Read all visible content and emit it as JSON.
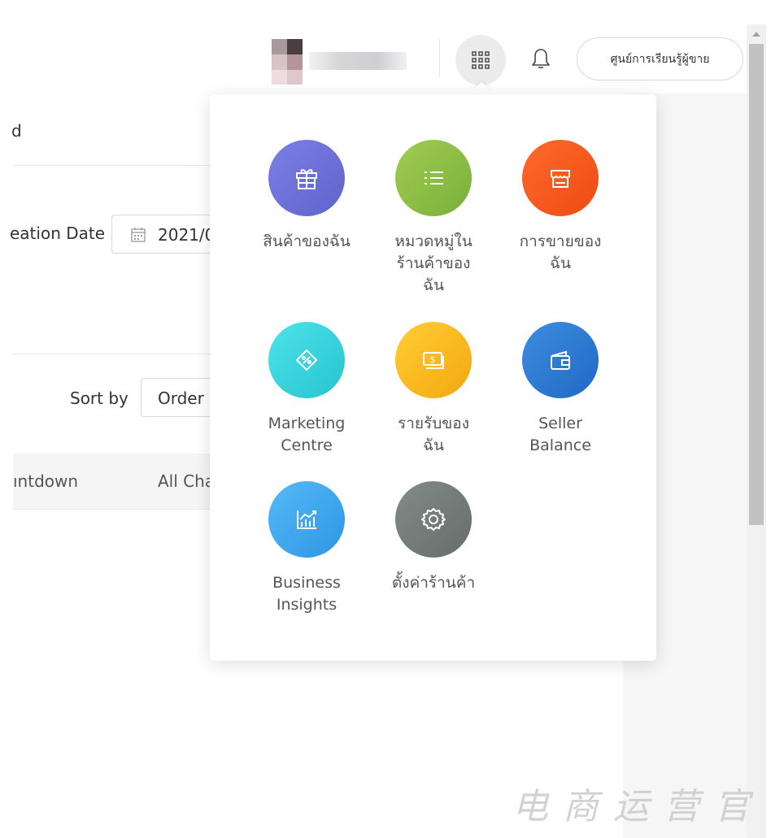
{
  "header": {
    "learning_center_label": "ศูนย์การเรียนรู้ผู้ขาย",
    "apps_icon": "grid-icon",
    "bell_icon": "bell-icon"
  },
  "page": {
    "crumb_text": "d",
    "creation_date_label": "eation Date",
    "date_value": "2021/0",
    "sort_by_label": "Sort by",
    "sort_value": "Order (",
    "table_columns": [
      "ıntdown",
      "All Cha"
    ]
  },
  "apps_menu": {
    "items": [
      {
        "label": "สินค้าของฉัน",
        "icon": "gift-icon",
        "color": "#6f74d6"
      },
      {
        "label": "หมวดหมู่ใน\nร้านค้าของ\nฉัน",
        "icon": "list-icon",
        "color": "#8bbf44"
      },
      {
        "label": "การขายของ\nฉัน",
        "icon": "store-icon",
        "color": "#f5561d"
      },
      {
        "label": "Marketing\nCentre",
        "icon": "discount-tag-icon",
        "color": "#37d2dc"
      },
      {
        "label": "รายรับของ\nฉัน",
        "icon": "money-icon",
        "color": "#fbb41c"
      },
      {
        "label": "Seller\nBalance",
        "icon": "wallet-icon",
        "color": "#2f7fd6"
      },
      {
        "label": "Business\nInsights",
        "icon": "chart-icon",
        "color": "#3fa9ef"
      },
      {
        "label": "ตั้งค่าร้านค้า",
        "icon": "gear-icon",
        "color": "#727b79"
      }
    ]
  },
  "watermark": "电商运营官"
}
